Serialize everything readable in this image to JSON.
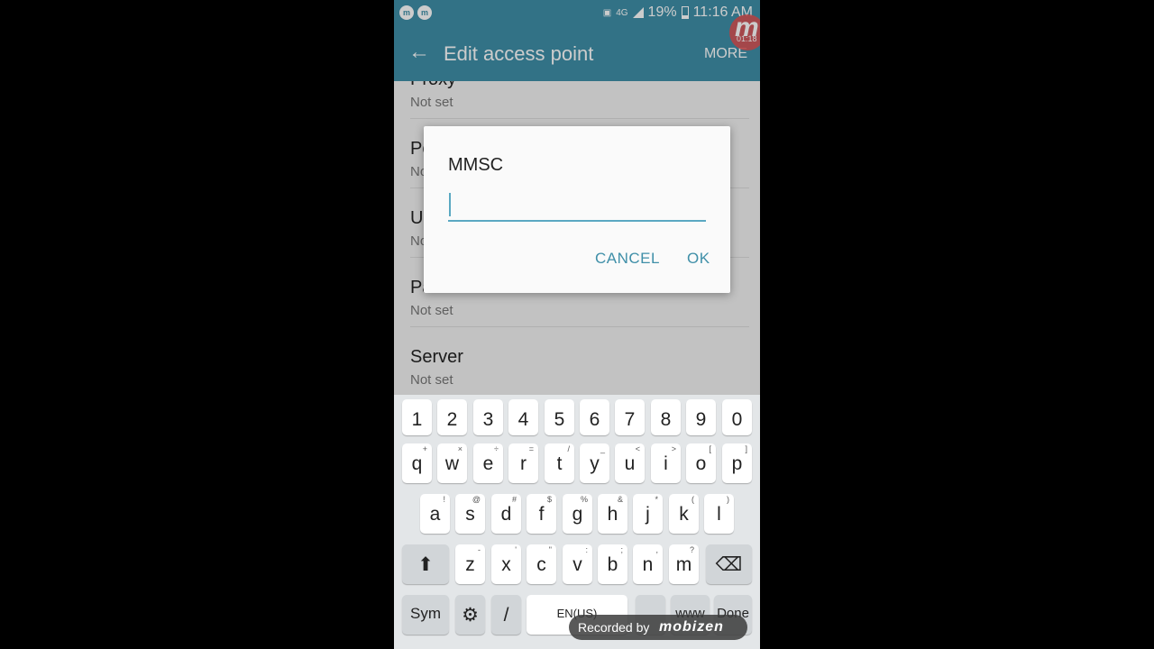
{
  "status_bar": {
    "left_icons": [
      "messenger-icon",
      "messenger-icon"
    ],
    "network": "4G",
    "battery": "19%",
    "time": "11:16 AM"
  },
  "action_bar": {
    "title": "Edit access point",
    "more_label": "MORE"
  },
  "recorder": {
    "badge_letter": "m",
    "badge_time": "01:18",
    "watermark_label": "Recorded by",
    "watermark_brand": "mobizen"
  },
  "list": {
    "items": [
      {
        "title": "Proxy",
        "value": "Not set"
      },
      {
        "title": "Port",
        "value": "Not set"
      },
      {
        "title": "Username",
        "value": "Not set"
      },
      {
        "title": "Password",
        "value": "Not set"
      },
      {
        "title": "Server",
        "value": "Not set"
      }
    ]
  },
  "dialog": {
    "title": "MMSC",
    "input_value": "",
    "cancel_label": "CANCEL",
    "ok_label": "OK"
  },
  "keyboard": {
    "number_row": [
      "1",
      "2",
      "3",
      "4",
      "5",
      "6",
      "7",
      "8",
      "9",
      "0"
    ],
    "row1": [
      {
        "k": "q",
        "h": "+"
      },
      {
        "k": "w",
        "h": "×"
      },
      {
        "k": "e",
        "h": "÷"
      },
      {
        "k": "r",
        "h": "="
      },
      {
        "k": "t",
        "h": "/"
      },
      {
        "k": "y",
        "h": "_"
      },
      {
        "k": "u",
        "h": "<"
      },
      {
        "k": "i",
        "h": ">"
      },
      {
        "k": "o",
        "h": "["
      },
      {
        "k": "p",
        "h": "]"
      }
    ],
    "row2": [
      {
        "k": "a",
        "h": "!"
      },
      {
        "k": "s",
        "h": "@"
      },
      {
        "k": "d",
        "h": "#"
      },
      {
        "k": "f",
        "h": "$"
      },
      {
        "k": "g",
        "h": "%"
      },
      {
        "k": "h",
        "h": "&"
      },
      {
        "k": "j",
        "h": "*"
      },
      {
        "k": "k",
        "h": "("
      },
      {
        "k": "l",
        "h": ")"
      }
    ],
    "row3": [
      {
        "k": "z",
        "h": "-"
      },
      {
        "k": "x",
        "h": "'"
      },
      {
        "k": "c",
        "h": "\""
      },
      {
        "k": "v",
        "h": ":"
      },
      {
        "k": "b",
        "h": ";"
      },
      {
        "k": "n",
        "h": ","
      },
      {
        "k": "m",
        "h": "?"
      }
    ],
    "sym_label": "Sym",
    "slash_label": "/",
    "space_label": "EN(US)",
    "www_label": "www",
    "done_label": "Done"
  }
}
